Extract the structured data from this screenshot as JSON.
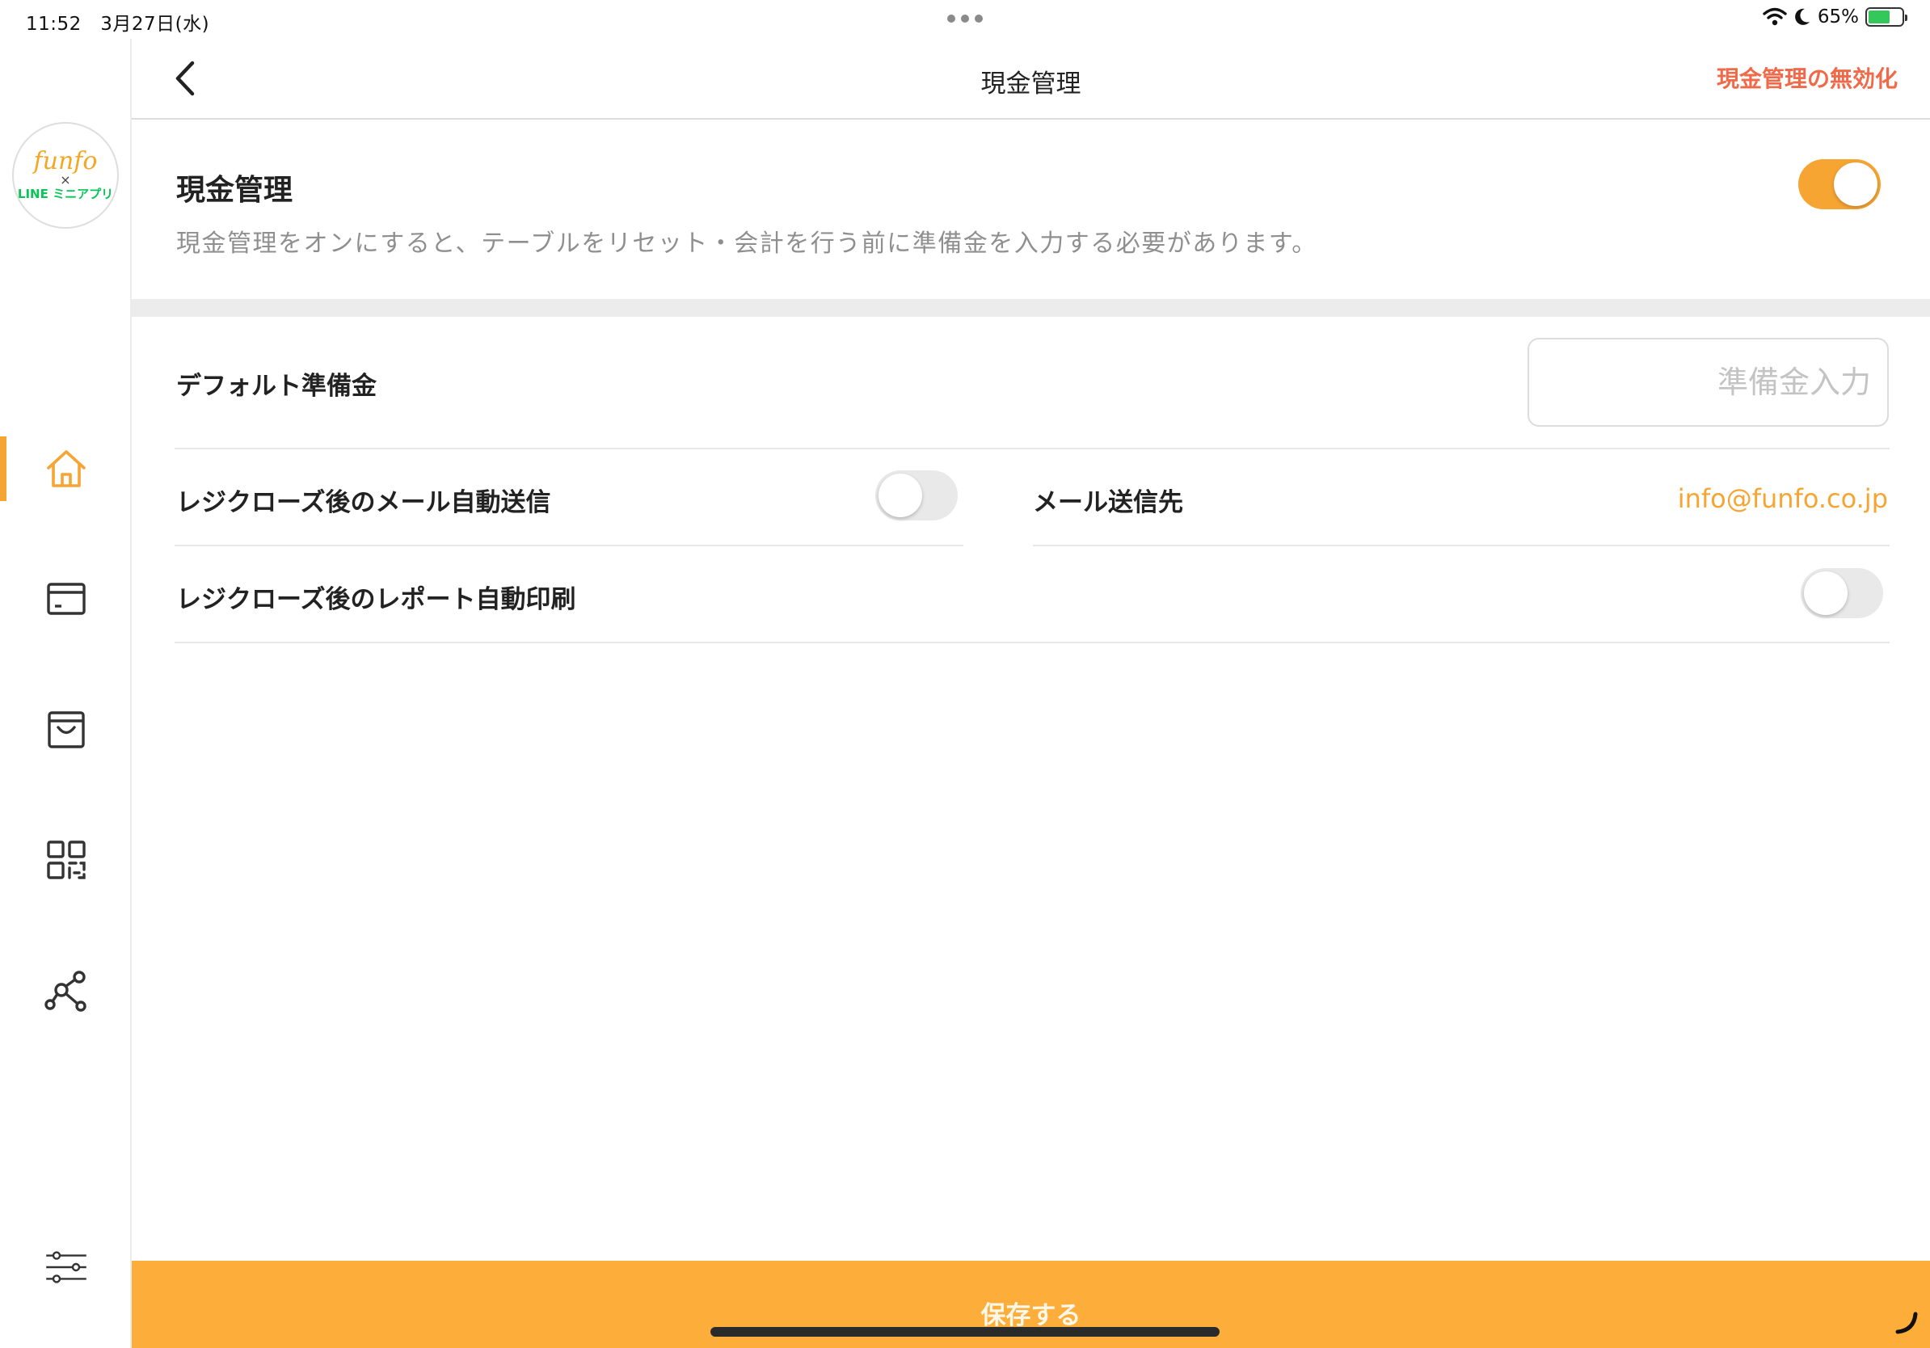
{
  "status_bar": {
    "time": "11:52",
    "date": "3月27日(水)",
    "battery_pct": "65%",
    "battery_level": 0.65,
    "battery_color": "#34c759",
    "icons": [
      "wifi-icon",
      "moon-icon",
      "battery-charging-icon"
    ]
  },
  "sidebar": {
    "logo": {
      "line1": "funfo",
      "line2": "×",
      "line3": "LINE ミニアプリ"
    },
    "items": [
      {
        "name": "home",
        "icon": "home-icon",
        "active": true
      },
      {
        "name": "register",
        "icon": "register-icon",
        "active": false
      },
      {
        "name": "orders",
        "icon": "shopping-bag-icon",
        "active": false
      },
      {
        "name": "qr",
        "icon": "qr-code-icon",
        "active": false
      },
      {
        "name": "network",
        "icon": "network-icon",
        "active": false
      },
      {
        "name": "settings",
        "icon": "sliders-icon",
        "active": false
      }
    ]
  },
  "header": {
    "title": "現金管理",
    "disable_label": "現金管理の無効化",
    "back_icon": "chevron-left-icon"
  },
  "cash_management": {
    "title": "現金管理",
    "description": "現金管理をオンにすると、テーブルをリセット・会計を行う前に準備金を入力する必要があります。",
    "enabled": true
  },
  "default_reserve": {
    "label": "デフォルト準備金",
    "value": "",
    "placeholder": "準備金入力"
  },
  "auto_mail": {
    "label": "レジクローズ後のメール自動送信",
    "enabled": false,
    "recipient_label": "メール送信先",
    "recipient_value": "info@funfo.co.jp"
  },
  "auto_print": {
    "label": "レジクローズ後のレポート自動印刷",
    "enabled": false
  },
  "footer": {
    "save_label": "保存する"
  },
  "colors": {
    "accent": "#f7a532",
    "save_bar": "#fcad3a",
    "danger": "#f06a4a",
    "line_green": "#06c755"
  }
}
